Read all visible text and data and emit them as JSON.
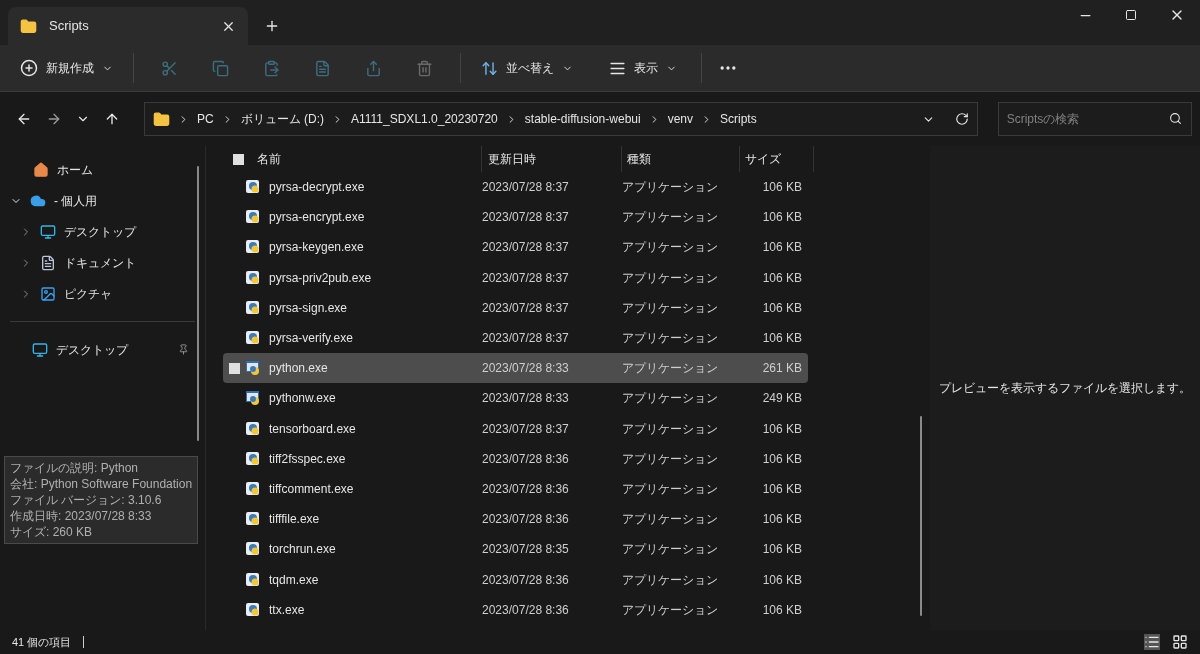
{
  "tab": {
    "title": "Scripts"
  },
  "toolbar": {
    "new_label": "新規作成",
    "sort_label": "並べ替え",
    "view_label": "表示"
  },
  "breadcrumb": [
    "PC",
    "ボリューム (D:)",
    "A1111_SDXL1.0_20230720",
    "stable-diffusion-webui",
    "venv",
    "Scripts"
  ],
  "search": {
    "placeholder": "Scriptsの検索"
  },
  "sidebar": {
    "items": [
      {
        "label": "ホーム",
        "kind": "home"
      },
      {
        "label": "- 個人用",
        "kind": "cloud",
        "expanded": true,
        "children": [
          {
            "label": "デスクトップ",
            "kind": "desktop",
            "expanded": false
          },
          {
            "label": "ドキュメント",
            "kind": "document",
            "expanded": false
          },
          {
            "label": "ピクチャ",
            "kind": "picture",
            "expanded": false
          }
        ]
      }
    ],
    "pinned": [
      {
        "label": "デスクトップ",
        "kind": "desktop"
      }
    ]
  },
  "table": {
    "select_all": {
      "checked": false
    },
    "columns": [
      "名前",
      "更新日時",
      "種類",
      "サイズ"
    ],
    "rows": [
      {
        "name": "pyrsa-decrypt.exe",
        "date": "2023/07/28 8:37",
        "type": "アプリケーション",
        "size": "106 KB",
        "selected": false,
        "kind": "script"
      },
      {
        "name": "pyrsa-encrypt.exe",
        "date": "2023/07/28 8:37",
        "type": "アプリケーション",
        "size": "106 KB",
        "selected": false,
        "kind": "script"
      },
      {
        "name": "pyrsa-keygen.exe",
        "date": "2023/07/28 8:37",
        "type": "アプリケーション",
        "size": "106 KB",
        "selected": false,
        "kind": "script"
      },
      {
        "name": "pyrsa-priv2pub.exe",
        "date": "2023/07/28 8:37",
        "type": "アプリケーション",
        "size": "106 KB",
        "selected": false,
        "kind": "script"
      },
      {
        "name": "pyrsa-sign.exe",
        "date": "2023/07/28 8:37",
        "type": "アプリケーション",
        "size": "106 KB",
        "selected": false,
        "kind": "script"
      },
      {
        "name": "pyrsa-verify.exe",
        "date": "2023/07/28 8:37",
        "type": "アプリケーション",
        "size": "106 KB",
        "selected": false,
        "kind": "script"
      },
      {
        "name": "python.exe",
        "date": "2023/07/28 8:33",
        "type": "アプリケーション",
        "size": "261 KB",
        "selected": true,
        "kind": "python"
      },
      {
        "name": "pythonw.exe",
        "date": "2023/07/28 8:33",
        "type": "アプリケーション",
        "size": "249 KB",
        "selected": false,
        "kind": "python"
      },
      {
        "name": "tensorboard.exe",
        "date": "2023/07/28 8:37",
        "type": "アプリケーション",
        "size": "106 KB",
        "selected": false,
        "kind": "script"
      },
      {
        "name": "tiff2fsspec.exe",
        "date": "2023/07/28 8:36",
        "type": "アプリケーション",
        "size": "106 KB",
        "selected": false,
        "kind": "script"
      },
      {
        "name": "tiffcomment.exe",
        "date": "2023/07/28 8:36",
        "type": "アプリケーション",
        "size": "106 KB",
        "selected": false,
        "kind": "script"
      },
      {
        "name": "tifffile.exe",
        "date": "2023/07/28 8:36",
        "type": "アプリケーション",
        "size": "106 KB",
        "selected": false,
        "kind": "script"
      },
      {
        "name": "torchrun.exe",
        "date": "2023/07/28 8:35",
        "type": "アプリケーション",
        "size": "106 KB",
        "selected": false,
        "kind": "script"
      },
      {
        "name": "tqdm.exe",
        "date": "2023/07/28 8:36",
        "type": "アプリケーション",
        "size": "106 KB",
        "selected": false,
        "kind": "script"
      },
      {
        "name": "ttx.exe",
        "date": "2023/07/28 8:36",
        "type": "アプリケーション",
        "size": "106 KB",
        "selected": false,
        "kind": "script"
      }
    ]
  },
  "tooltip": [
    "ファイルの説明: Python",
    "会社: Python Software Foundation",
    "ファイル バージョン: 3.10.6",
    "作成日時: 2023/07/28 8:33",
    "サイズ: 260 KB"
  ],
  "preview": {
    "message": "プレビューを表示するファイルを選択します。"
  },
  "status_bar": {
    "count": "41 個の項目"
  }
}
